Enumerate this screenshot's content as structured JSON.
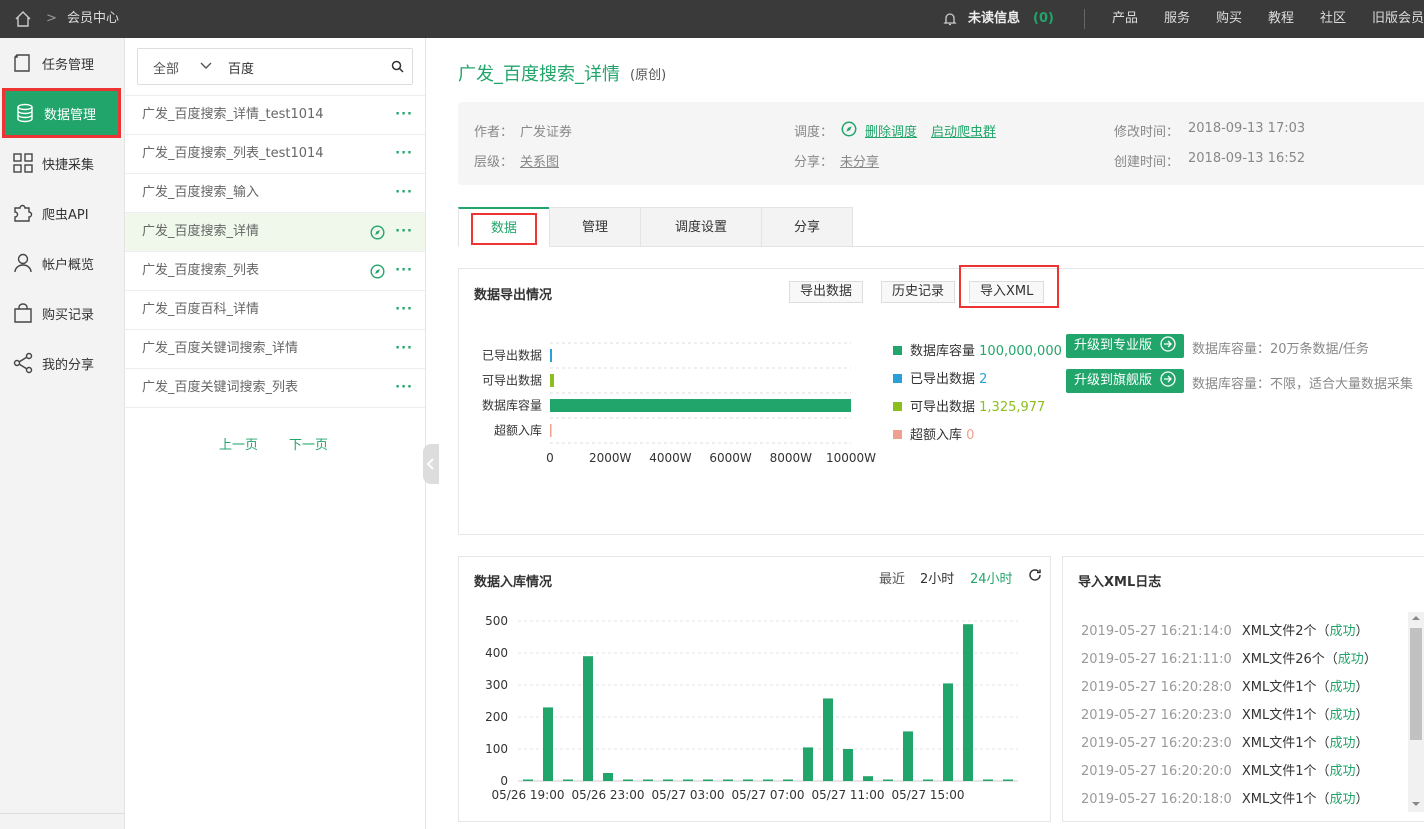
{
  "topbar": {
    "breadcrumb": "会员中心",
    "unread_label": "未读信息",
    "unread_count": "(0)",
    "nav": [
      "产品",
      "服务",
      "购买",
      "教程",
      "社区",
      "旧版会员"
    ]
  },
  "sidebar": {
    "items": [
      {
        "label": "任务管理",
        "icon": "task-icon"
      },
      {
        "label": "数据管理",
        "icon": "database-icon"
      },
      {
        "label": "快捷采集",
        "icon": "grid-icon"
      },
      {
        "label": "爬虫API",
        "icon": "puzzle-icon"
      },
      {
        "label": "帐户概览",
        "icon": "user-icon"
      },
      {
        "label": "购买记录",
        "icon": "bag-icon"
      },
      {
        "label": "我的分享",
        "icon": "share-icon"
      }
    ]
  },
  "tasklist": {
    "filter": "全部",
    "search_value": "百度",
    "items": [
      "广发_百度搜索_详情_test1014",
      "广发_百度搜索_列表_test1014",
      "广发_百度搜索_输入",
      "广发_百度搜索_详情",
      "广发_百度搜索_列表",
      "广发_百度百科_详情",
      "广发_百度关键词搜索_详情",
      "广发_百度关键词搜索_列表"
    ],
    "prev": "上一页",
    "next": "下一页"
  },
  "detail": {
    "title": "广发_百度搜索_详情",
    "tag": "(原创)",
    "author_label": "作者：",
    "author": "广发证券",
    "level_label": "层级：",
    "level": "关系图",
    "schedule_label": "调度：",
    "delete_schedule": "删除调度",
    "start_cluster": "启动爬虫群",
    "share_label": "分享：",
    "share": "未分享",
    "modified_label": "修改时间：",
    "modified": "2018-09-13 17:03",
    "created_label": "创建时间：",
    "created": "2018-09-13 16:52"
  },
  "tabs": [
    "数据",
    "管理",
    "调度设置",
    "分享"
  ],
  "export": {
    "title": "数据导出情况",
    "btn_export": "导出数据",
    "btn_history": "历史记录",
    "btn_import": "导入XML",
    "legend": [
      {
        "label": "数据库容量",
        "value": "100,000,000",
        "color": "#22a56b"
      },
      {
        "label": "已导出数据",
        "value": "2",
        "color": "#2aa0d8"
      },
      {
        "label": "可导出数据",
        "value": "1,325,977",
        "color": "#8cbf1e"
      },
      {
        "label": "超额入库",
        "value": "0",
        "color": "#f0a090"
      }
    ],
    "upgrade_pro": "升级到专业版",
    "upgrade_pro_desc": "数据库容量：20万条数据/任务",
    "upgrade_flag": "升级到旗舰版",
    "upgrade_flag_desc": "数据库容量：不限，适合大量数据采集"
  },
  "ingest": {
    "title": "数据入库情况",
    "recent": "最近",
    "opt1": "2小时",
    "opt2": "24小时"
  },
  "log": {
    "title": "导入XML日志",
    "rows": [
      {
        "time": "2019-05-27 16:21:14:0",
        "msg": "XML文件2个",
        "status": "成功"
      },
      {
        "time": "2019-05-27 16:21:11:0",
        "msg": "XML文件26个",
        "status": "成功"
      },
      {
        "time": "2019-05-27 16:20:28:0",
        "msg": "XML文件1个",
        "status": "成功"
      },
      {
        "time": "2019-05-27 16:20:23:0",
        "msg": "XML文件1个",
        "status": "成功"
      },
      {
        "time": "2019-05-27 16:20:23:0",
        "msg": "XML文件1个",
        "status": "成功"
      },
      {
        "time": "2019-05-27 16:20:20:0",
        "msg": "XML文件1个",
        "status": "成功"
      },
      {
        "time": "2019-05-27 16:20:18:0",
        "msg": "XML文件1个",
        "status": "成功"
      }
    ]
  },
  "chart_data": [
    {
      "type": "bar",
      "orientation": "horizontal",
      "categories": [
        "已导出数据",
        "可导出数据",
        "数据库容量",
        "超额入库"
      ],
      "values": [
        2,
        1325977,
        100000000,
        0
      ],
      "unit": "W",
      "xticks": [
        "0",
        "2000W",
        "4000W",
        "6000W",
        "8000W",
        "10000W"
      ],
      "xlim": [
        0,
        100000000
      ],
      "colors": [
        "#2aa0d8",
        "#8cbf1e",
        "#22a56b",
        "#f0a090"
      ]
    },
    {
      "type": "bar",
      "yticks": [
        "0",
        "100",
        "200",
        "300",
        "400",
        "500"
      ],
      "ylim": [
        0,
        500
      ],
      "xticks": [
        "05/26 19:00",
        "05/26 23:00",
        "05/27 03:00",
        "05/27 07:00",
        "05/27 11:00",
        "05/27 15:00"
      ],
      "values": [
        2,
        230,
        2,
        390,
        25,
        2,
        2,
        2,
        2,
        2,
        2,
        2,
        2,
        2,
        105,
        258,
        100,
        15,
        2,
        155,
        2,
        305,
        490,
        2,
        2
      ],
      "color": "#22a56b"
    }
  ]
}
